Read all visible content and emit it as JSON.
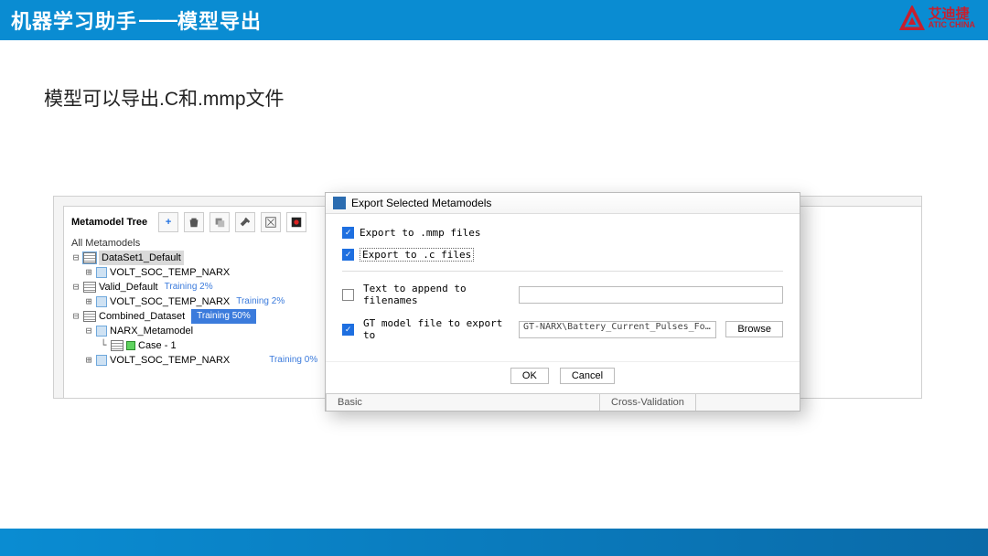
{
  "header": {
    "title_left": "机器学习助手",
    "title_right": "模型导出",
    "separator": "——"
  },
  "logo": {
    "cn": "艾迪捷",
    "en": "ATIC CHINA"
  },
  "subtitle": "模型可以导出.C和.mmp文件",
  "panel": {
    "title": "Metamodel Tree",
    "all_label": "All Metamodels"
  },
  "tree": {
    "dataset1": "DataSet1_Default",
    "volt1": "VOLT_SOC_TEMP_NARX",
    "valid": "Valid_Default",
    "valid_training": "Training 2%",
    "volt2": "VOLT_SOC_TEMP_NARX",
    "volt2_training": "Training 2%",
    "combined": "Combined_Dataset",
    "combined_training": "Training 50%",
    "narx": "NARX_Metamodel",
    "case1": "Case - 1",
    "volt3": "VOLT_SOC_TEMP_NARX",
    "volt3_training": "Training 0%"
  },
  "dialog": {
    "title": "Export Selected Metamodels",
    "export_mmp": "Export to .mmp files",
    "export_c": "Export to .c files",
    "append_label": "Text to append to filenames",
    "gtmodel_label": "GT model file to export to",
    "gtmodel_value": "GT-NARX\\Battery_Current_Pulses_For_ATIC_Export.gtm",
    "browse": "Browse",
    "ok": "OK",
    "cancel": "Cancel",
    "tab_basic": "Basic",
    "tab_cross": "Cross-Validation"
  }
}
